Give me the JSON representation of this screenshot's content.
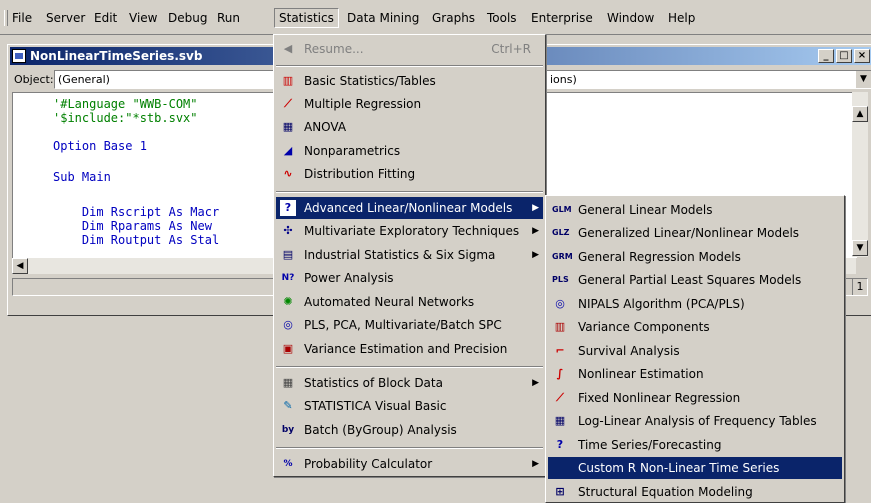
{
  "menubar": {
    "items": [
      "File",
      "Server",
      "Edit",
      "View",
      "Debug",
      "Run",
      "Statistics",
      "Data Mining",
      "Graphs",
      "Tools",
      "Enterprise",
      "Window",
      "Help"
    ],
    "active": "Statistics"
  },
  "window": {
    "title": "NonLinearTimeSeries.svb",
    "object_label": "Object:",
    "object_value": "(General)",
    "proc_value": "ions)",
    "status_pane": "1"
  },
  "code": [
    "'#Language \"WWB-COM\"",
    "'$include:\"*stb.svx\"",
    "",
    "Option Base 1",
    "",
    "Sub Main",
    "",
    "    Dim Rscript As Macr",
    "    Dim Rparams As New",
    "    Dim Routput As Stal"
  ],
  "stats_menu": {
    "items": [
      {
        "label": "Resume...",
        "shortcut": "Ctrl+R",
        "icon": "resume-icon",
        "disabled": true
      },
      {
        "sep": true
      },
      {
        "label": "Basic Statistics/Tables",
        "icon": "basic-stats-icon"
      },
      {
        "label": "Multiple Regression",
        "icon": "regression-icon"
      },
      {
        "label": "ANOVA",
        "icon": "anova-icon"
      },
      {
        "label": "Nonparametrics",
        "icon": "nonparametrics-icon"
      },
      {
        "label": "Distribution Fitting",
        "icon": "distribution-icon"
      },
      {
        "sep": true
      },
      {
        "label": "Advanced Linear/Nonlinear Models",
        "icon": "advanced-models-icon",
        "submenu": true,
        "highlight": true
      },
      {
        "label": "Multivariate Exploratory Techniques",
        "icon": "multivariate-icon",
        "submenu": true
      },
      {
        "label": "Industrial Statistics & Six Sigma",
        "icon": "industrial-icon",
        "submenu": true
      },
      {
        "label": "Power Analysis",
        "icon": "power-icon"
      },
      {
        "label": "Automated Neural Networks",
        "icon": "neural-icon"
      },
      {
        "label": "PLS, PCA, Multivariate/Batch SPC",
        "icon": "pls-pca-icon"
      },
      {
        "label": "Variance Estimation and Precision",
        "icon": "variance-icon"
      },
      {
        "sep": true
      },
      {
        "label": "Statistics of Block Data",
        "icon": "block-data-icon",
        "submenu": true
      },
      {
        "label": "STATISTICA Visual Basic",
        "icon": "svb-icon"
      },
      {
        "label": "Batch (ByGroup) Analysis",
        "icon": "batch-icon"
      },
      {
        "sep": true
      },
      {
        "label": "Probability Calculator",
        "icon": "probability-icon",
        "submenu": true
      }
    ]
  },
  "sub_menu": {
    "items": [
      {
        "label": "General Linear Models",
        "icon": "glm-icon"
      },
      {
        "label": "Generalized Linear/Nonlinear Models",
        "icon": "glz-icon"
      },
      {
        "label": "General Regression Models",
        "icon": "grm-icon"
      },
      {
        "label": "General Partial Least Squares Models",
        "icon": "pls-icon"
      },
      {
        "label": "NIPALS Algorithm (PCA/PLS)",
        "icon": "nipals-icon"
      },
      {
        "label": "Variance Components",
        "icon": "variance-components-icon"
      },
      {
        "label": "Survival Analysis",
        "icon": "survival-icon"
      },
      {
        "label": "Nonlinear Estimation",
        "icon": "nonlinear-estimation-icon"
      },
      {
        "label": "Fixed Nonlinear Regression",
        "icon": "fixed-nonlinear-icon"
      },
      {
        "label": "Log-Linear Analysis of Frequency Tables",
        "icon": "log-linear-icon"
      },
      {
        "label": "Time Series/Forecasting",
        "icon": "time-series-icon"
      },
      {
        "label": "Custom R Non-Linear Time Series",
        "icon": "",
        "highlight": true
      },
      {
        "label": "Structural Equation Modeling",
        "icon": "sem-icon"
      }
    ]
  },
  "colors": {
    "highlight": "#0a246a",
    "face": "#d4d0c8",
    "comment": "#008000",
    "keyword": "#0000c0"
  }
}
